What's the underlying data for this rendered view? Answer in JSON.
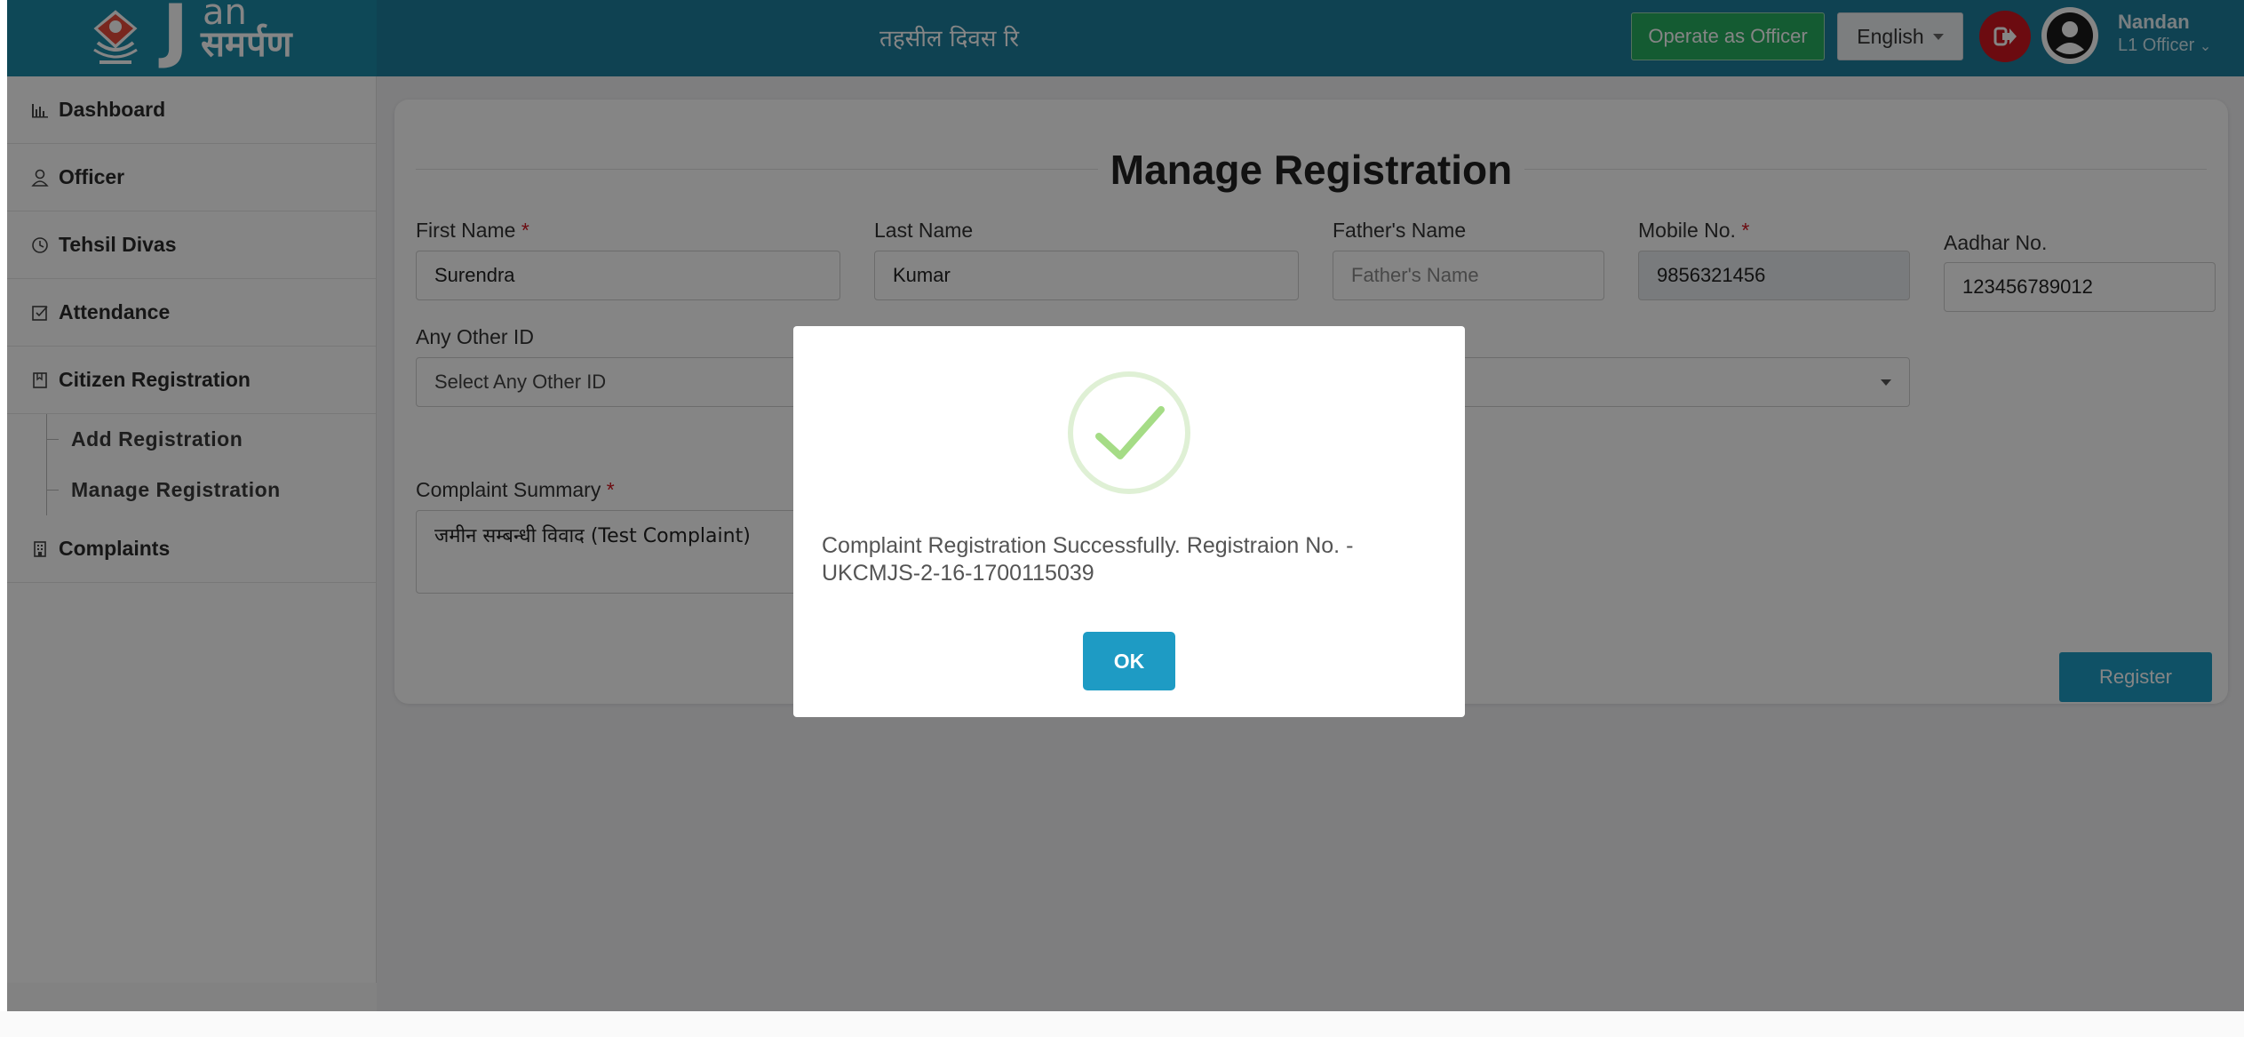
{
  "brand": {
    "name_j": "J",
    "name_an": "an",
    "name_hindi": "समर्पण"
  },
  "header": {
    "title": "तहसील दिवस रि",
    "operate_as_officer": "Operate as Officer",
    "language": "English",
    "user_name": "Nandan",
    "user_role": "L1 Officer"
  },
  "sidebar": {
    "items": [
      {
        "label": "Dashboard",
        "icon": "chart-icon"
      },
      {
        "label": "Officer",
        "icon": "user-icon"
      },
      {
        "label": "Tehsil Divas",
        "icon": "clock-icon"
      },
      {
        "label": "Attendance",
        "icon": "check-square-icon"
      },
      {
        "label": "Citizen Registration",
        "icon": "book-icon"
      }
    ],
    "sub_items": [
      "Add Registration",
      "Manage Registration"
    ],
    "complaints": {
      "label": "Complaints",
      "icon": "building-icon"
    }
  },
  "form": {
    "title": "Manage Registration",
    "first_name_label": "First Name",
    "first_name_value": "Surendra",
    "last_name_label": "Last Name",
    "last_name_value": "Kumar",
    "fathers_name_label": "Father's Name",
    "fathers_name_placeholder": "Father's Name",
    "mobile_label": "Mobile No.",
    "mobile_value": "9856321456",
    "aadhar_label": "Aadhar No.",
    "aadhar_value": "123456789012",
    "other_id_label": "Any Other ID",
    "other_id_value": "Select Any Other ID",
    "complaint_summary_label": "Complaint Summary",
    "complaint_summary_value": "जमीन सम्बन्धी विवाद (Test Complaint)",
    "required_mark": "*",
    "register_button": "Register"
  },
  "modal": {
    "message_line1": "Complaint Registration Successfully. Registraion No. -",
    "message_line2": "UKCMJS-2-16-1700115039",
    "ok_button": "OK",
    "icon": "success-check-icon"
  },
  "colors": {
    "header": "#1e7f9e",
    "accent": "#1e9bc4",
    "success": "#a5dc86",
    "logout": "#d0161f",
    "officer_button": "#27ae60"
  }
}
